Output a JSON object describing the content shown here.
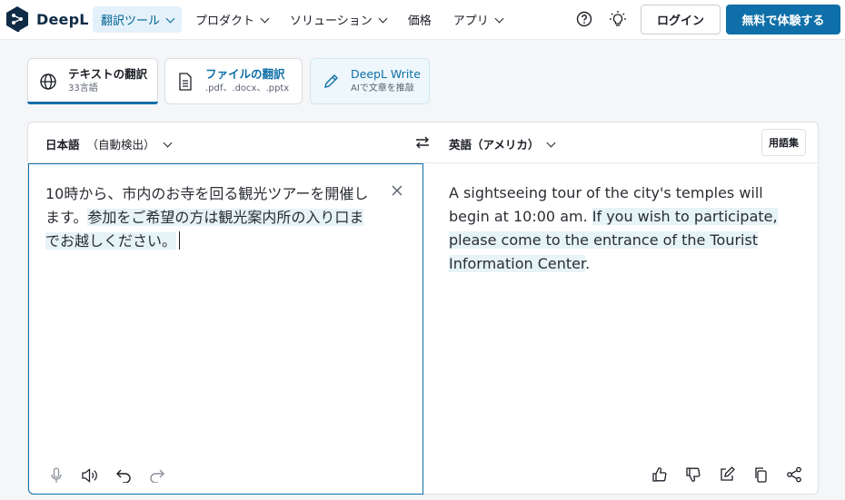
{
  "brand": {
    "name": "DeepL",
    "logo_color": "#0f2b46"
  },
  "nav": {
    "items": [
      {
        "label": "翻訳ツール",
        "active": true
      },
      {
        "label": "プロダクト",
        "active": false
      },
      {
        "label": "ソリューション",
        "active": false
      },
      {
        "label": "価格",
        "active": false
      },
      {
        "label": "アプリ",
        "active": false
      }
    ],
    "help_icon": "help-circle-icon",
    "tips_icon": "lightbulb-icon",
    "login_label": "ログイン",
    "trial_label": "無料で体験する"
  },
  "mode_tabs": [
    {
      "title": "テキストの翻訳",
      "subtitle": "33言語",
      "icon": "globe-icon",
      "active": true
    },
    {
      "title": "ファイルの翻訳",
      "subtitle": ".pdf、.docx、.pptx",
      "icon": "document-icon",
      "active": false
    },
    {
      "title": "DeepL Write",
      "subtitle": "AIで文章を推敲",
      "icon": "pen-icon",
      "active": false
    }
  ],
  "translator": {
    "source_lang": "日本語",
    "source_lang_note": "（自動検出）",
    "target_lang": "英語（アメリカ）",
    "glossary_label": "用語集",
    "source_text_part1": "10時から、市内のお寺を回る観光ツアーを開催します。",
    "source_text_part2": "参加をご希望の方は観光案内所の入り口までお越しください。",
    "target_text_part1": "A sightseeing tour of the city's temples will begin at 10:00 am. ",
    "target_text_part2": "If you wish to participate, please come to the entrance of the Tourist Information Center",
    "target_text_end": "."
  },
  "colors": {
    "accent": "#0f6fa8",
    "highlight": "#e6f3f7",
    "active_nav_bg": "#e4f1fb",
    "write_tab_bg": "#eef7fb"
  }
}
